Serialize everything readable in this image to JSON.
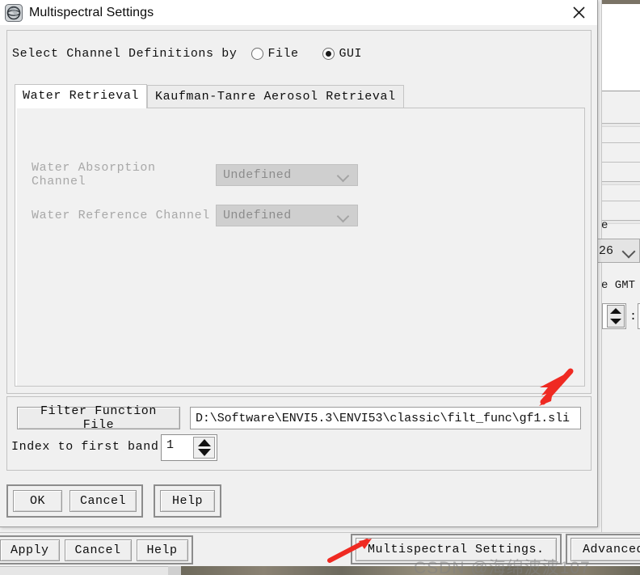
{
  "dialog": {
    "title": "Multispectral Settings",
    "icon": "envi-globe-icon",
    "close_label": "✕",
    "select_channel_label": "Select Channel Definitions by",
    "radio_options": [
      {
        "label": "File",
        "checked": false
      },
      {
        "label": "GUI",
        "checked": true
      }
    ],
    "tabs": [
      {
        "label": "Water Retrieval",
        "active": true
      },
      {
        "label": "Kaufman-Tanre Aerosol Retrieval",
        "active": false
      }
    ],
    "fields": [
      {
        "label": "Water Absorption Channel",
        "value": "Undefined",
        "disabled": true
      },
      {
        "label": "Water Reference Channel",
        "value": "Undefined",
        "disabled": true
      }
    ],
    "filter_section": {
      "button_label": "Filter Function File",
      "path_value": "D:\\Software\\ENVI5.3\\ENVI53\\classic\\filt_func\\gf1.sli",
      "index_label": "Index to first band",
      "index_value": "1"
    },
    "buttons": {
      "ok": "OK",
      "cancel": "Cancel",
      "help": "Help"
    }
  },
  "bottom_bar": {
    "apply": "Apply",
    "cancel": "Cancel",
    "help": "Help",
    "multispectral_settings": "Multispectral Settings.",
    "advanced": "Advanced"
  },
  "background_panel": {
    "label_e_top": "e",
    "combo_value": "26",
    "label_e_gmt": "e GMT",
    "colon": ":"
  },
  "annotations": {
    "arrow_color": "#ef2a22",
    "watermark": "CSDN @海绵波波107"
  }
}
